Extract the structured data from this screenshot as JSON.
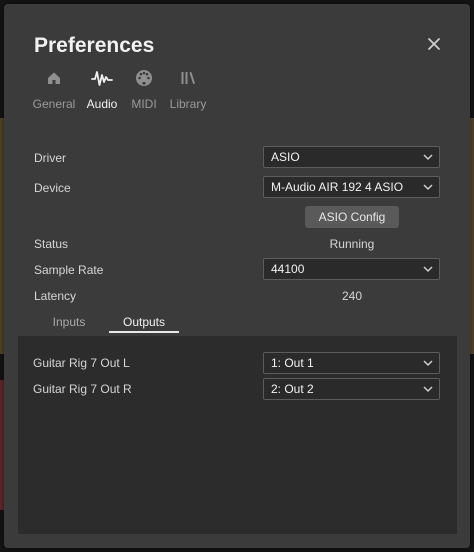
{
  "dialog": {
    "title": "Preferences",
    "close_icon": "close-icon"
  },
  "tabs": [
    {
      "label": "General",
      "icon": "home-icon",
      "active": false
    },
    {
      "label": "Audio",
      "icon": "waveform-icon",
      "active": true
    },
    {
      "label": "MIDI",
      "icon": "midi-icon",
      "active": false
    },
    {
      "label": "Library",
      "icon": "library-icon",
      "active": false
    }
  ],
  "audio": {
    "driver_label": "Driver",
    "driver_value": "ASIO",
    "device_label": "Device",
    "device_value": "M-Audio AIR 192 4 ASIO",
    "asio_config_label": "ASIO Config",
    "status_label": "Status",
    "status_value": "Running",
    "sample_rate_label": "Sample Rate",
    "sample_rate_value": "44100",
    "latency_label": "Latency",
    "latency_value": "240"
  },
  "io_tabs": {
    "inputs_label": "Inputs",
    "outputs_label": "Outputs",
    "active": "Outputs"
  },
  "outputs": [
    {
      "name": "Guitar Rig 7 Out L",
      "value": "1: Out 1"
    },
    {
      "name": "Guitar Rig 7 Out R",
      "value": "2: Out 2"
    }
  ],
  "colors": {
    "dialog_bg": "#3b3b3b",
    "panel_bg": "#2c2c2c",
    "text_active": "#f2f2f2",
    "text_muted": "#9a9a9a"
  }
}
